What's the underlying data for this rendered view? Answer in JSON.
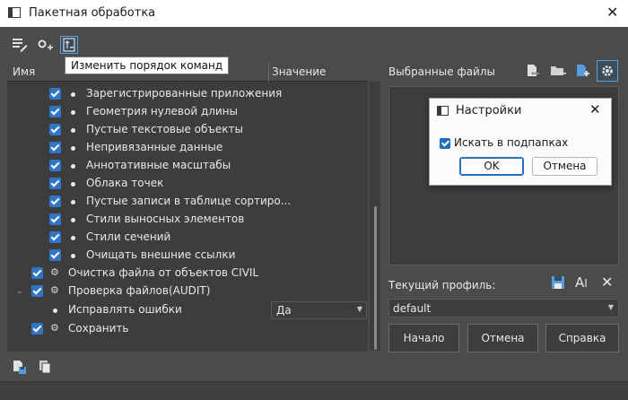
{
  "window": {
    "title": "Пакетная обработка"
  },
  "toolbar": {
    "tooltip": "Изменить порядок команд"
  },
  "tree": {
    "col_name": "Имя",
    "col_value": "Значение",
    "items": [
      {
        "label": "Зарегистрированные приложения",
        "checked": true
      },
      {
        "label": "Геометрия нулевой длины",
        "checked": true
      },
      {
        "label": "Пустые текстовые объекты",
        "checked": true
      },
      {
        "label": "Непривязанные данные",
        "checked": true
      },
      {
        "label": "Аннотативные масштабы",
        "checked": true
      },
      {
        "label": "Облака точек",
        "checked": true
      },
      {
        "label": "Пустые записи в таблице сортиро...",
        "checked": true
      },
      {
        "label": "Стили выносных элементов",
        "checked": true
      },
      {
        "label": "Стили сечений",
        "checked": true
      },
      {
        "label": "Очищать внешние ссылки",
        "checked": true
      },
      {
        "label": "Очистка файла от объектов CIVIL",
        "checked": true
      },
      {
        "label": "Проверка файлов(AUDIT)",
        "checked": true
      },
      {
        "label": "Исправлять ошибки",
        "value": "Да"
      },
      {
        "label": "Сохранить",
        "checked": true
      }
    ]
  },
  "files": {
    "label": "Выбранные файлы"
  },
  "profile": {
    "label": "Текущий профиль:",
    "value": "default"
  },
  "buttons": {
    "start": "Начало",
    "cancel": "Отмена",
    "help": "Справка"
  },
  "dialog": {
    "title": "Настройки",
    "checkbox_label": "Искать в подпапках",
    "ok": "OK",
    "cancel": "Отмена"
  },
  "colors": {
    "accent": "#2f75c4",
    "background": "#4b4b4b",
    "panel": "#3d3d3d"
  }
}
